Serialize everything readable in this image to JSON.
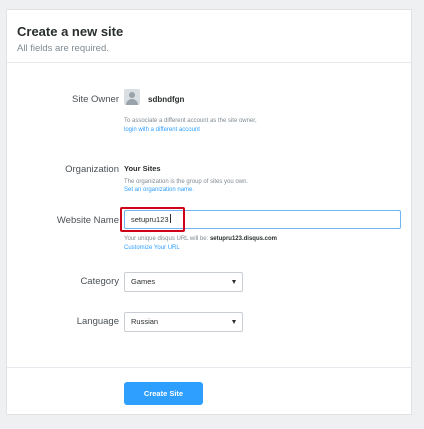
{
  "header": {
    "title": "Create a new site",
    "subtitle": "All fields are required."
  },
  "site_owner": {
    "label": "Site Owner",
    "name": "sdbndfgn",
    "help": "To associate a different account as the site owner,",
    "link": "login with a different account"
  },
  "organization": {
    "label": "Organization",
    "value": "Your Sites",
    "help": "The organization is the group of sites you own.",
    "link": "Set an organization name."
  },
  "website_name": {
    "label": "Website Name",
    "value": "setupru123",
    "help_prefix": "Your unique disqus URL will be:",
    "help_url": "setupru123.disqus.com",
    "link": "Customize Your URL"
  },
  "category": {
    "label": "Category",
    "selected": "Games"
  },
  "language": {
    "label": "Language",
    "selected": "Russian"
  },
  "footer": {
    "submit_label": "Create Site"
  },
  "colors": {
    "accent": "#2e9fff",
    "highlight": "#d0021b"
  }
}
